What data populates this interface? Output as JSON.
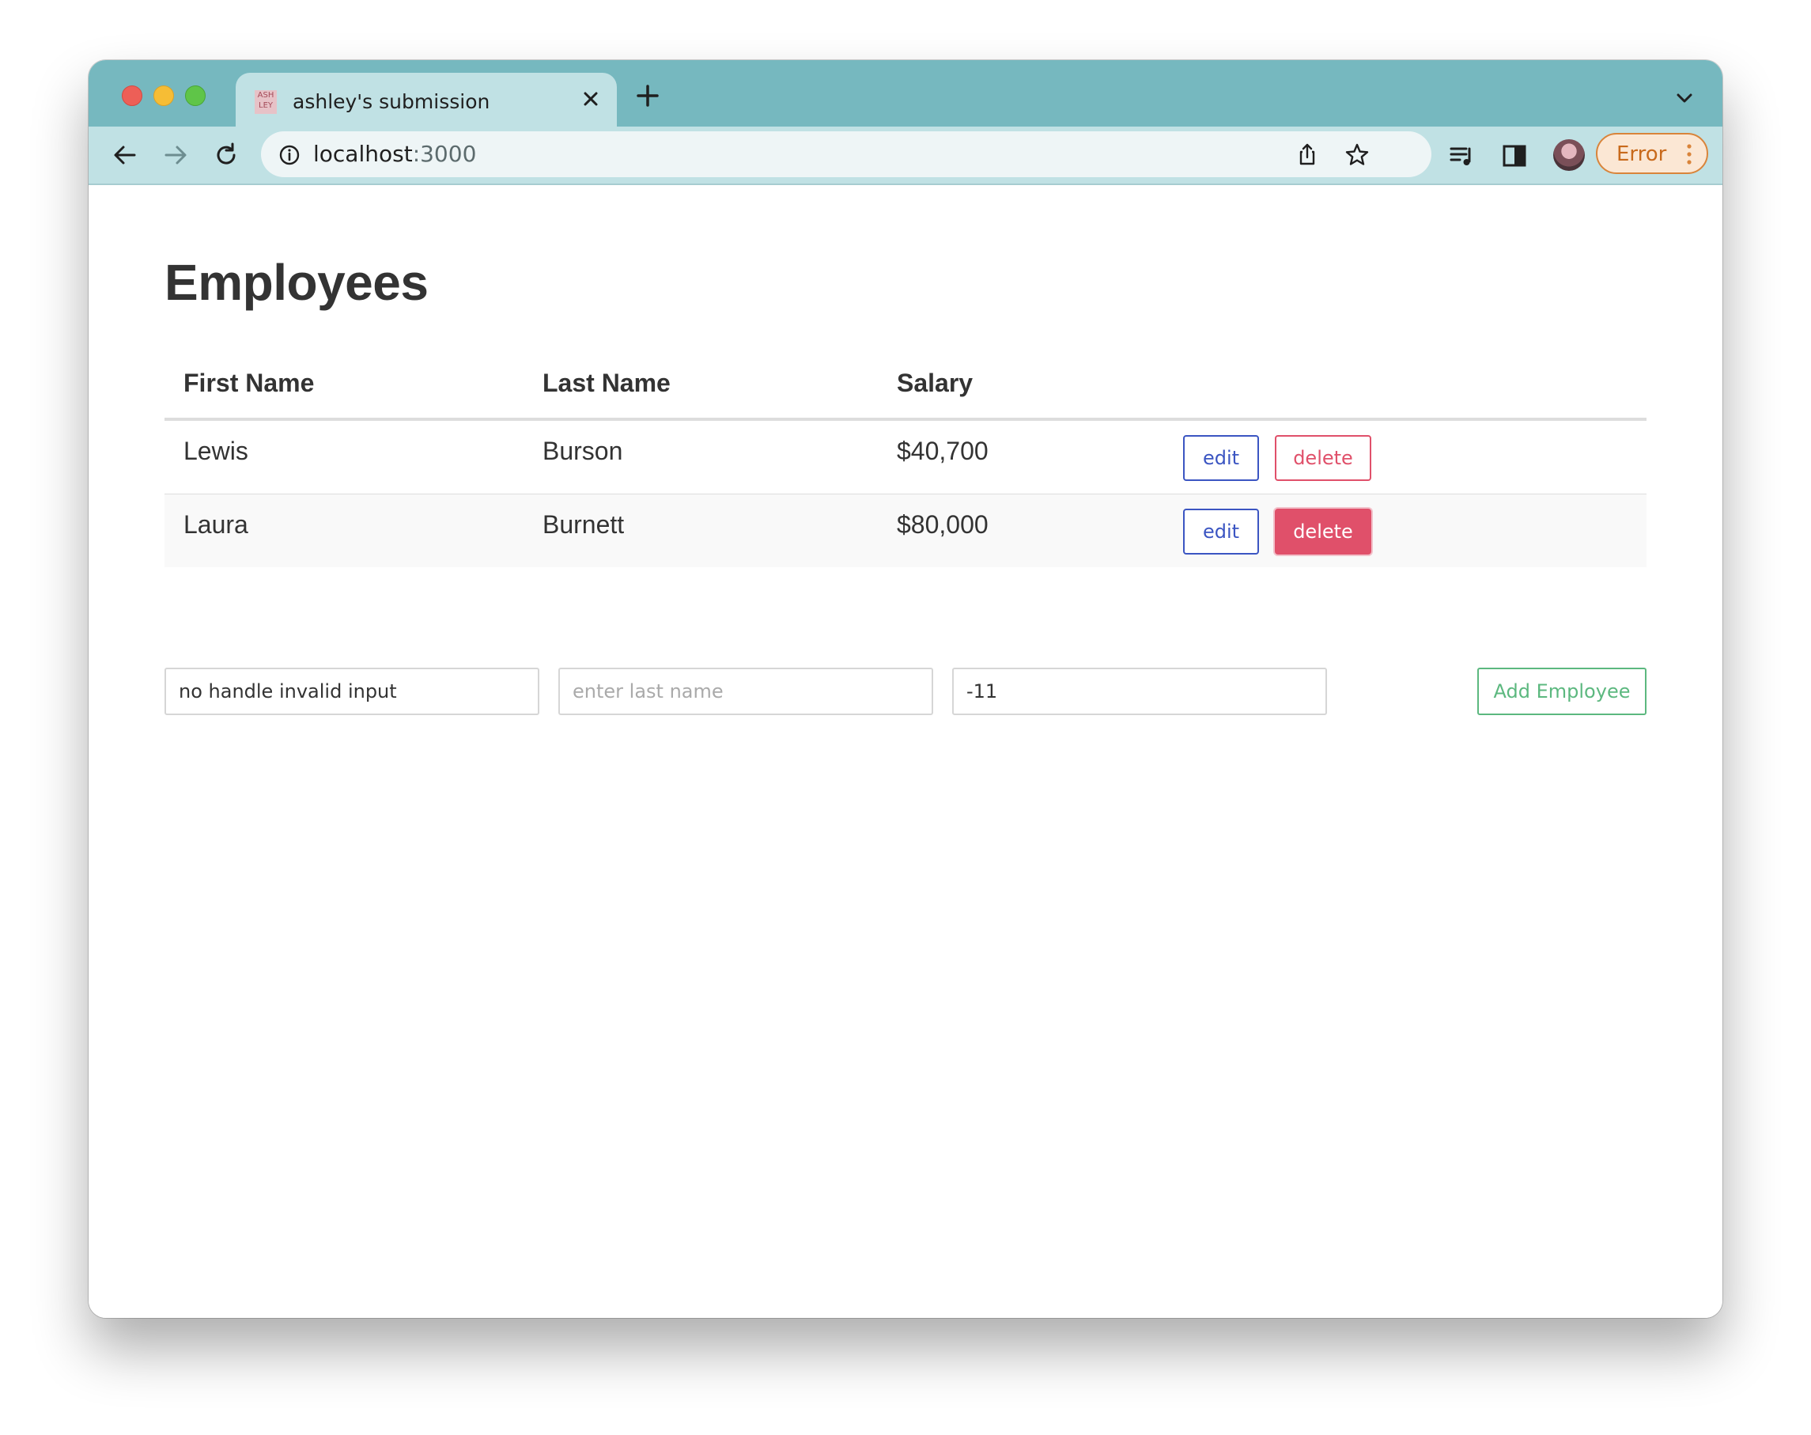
{
  "browser": {
    "tab": {
      "favicon_text": "ASH LEY",
      "title": "ashley's submission"
    },
    "address": {
      "host": "localhost",
      "port": ":3000"
    },
    "profile_status": "Error"
  },
  "page": {
    "title": "Employees",
    "table": {
      "columns": [
        "First Name",
        "Last Name",
        "Salary"
      ],
      "rows": [
        {
          "first": "Lewis",
          "last": "Burson",
          "salary": "$40,700",
          "edit": "edit",
          "delete": "delete"
        },
        {
          "first": "Laura",
          "last": "Burnett",
          "salary": "$80,000",
          "edit": "edit",
          "delete": "delete"
        }
      ]
    },
    "form": {
      "first_name_value": "no handle invalid input",
      "last_name_placeholder": "enter last name",
      "salary_value": "-11",
      "add_label": "Add Employee"
    }
  },
  "colors": {
    "chrome_frame": "#76b8bf",
    "chrome_toolbar": "#c0e1e4",
    "edit": "#3b55c2",
    "delete": "#e0506a",
    "add": "#5cb87f",
    "error": "#d9843a"
  }
}
